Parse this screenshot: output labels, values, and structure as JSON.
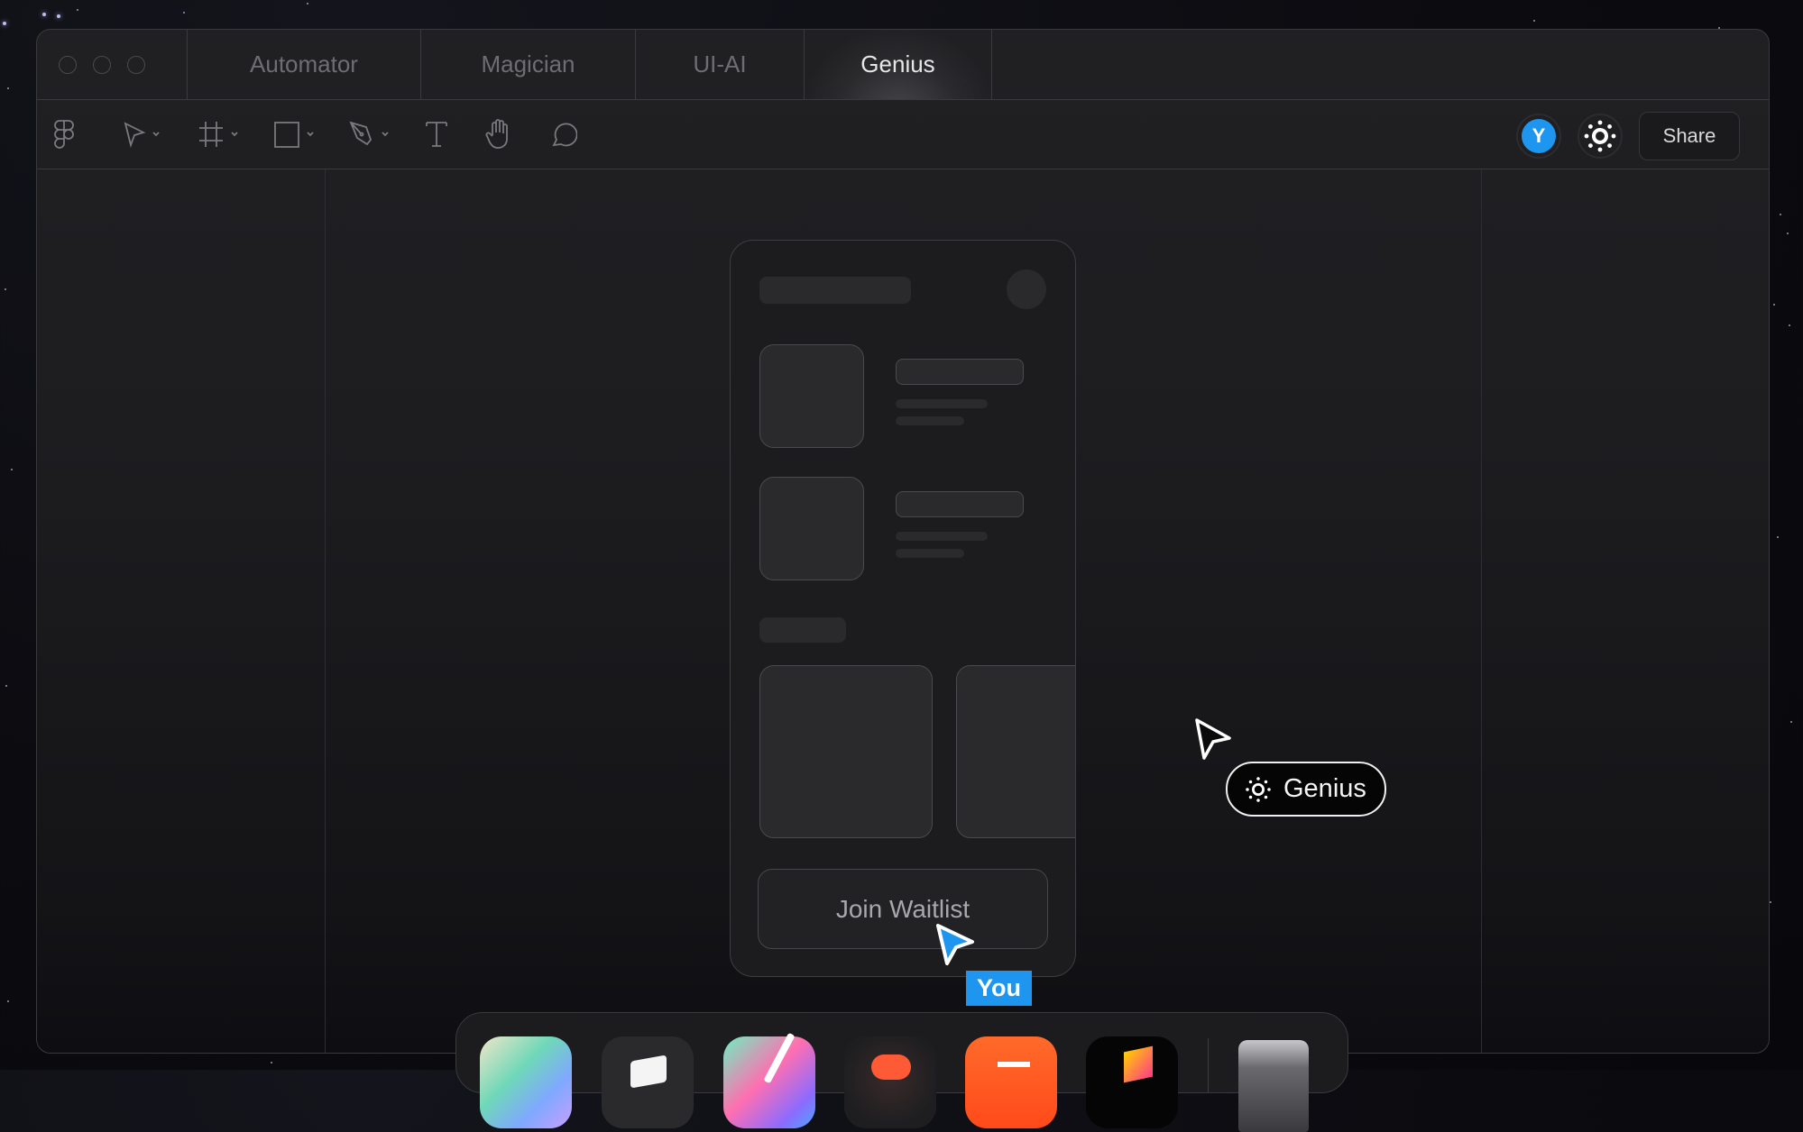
{
  "window": {
    "traffic_lights": [
      "close",
      "minimize",
      "maximize"
    ],
    "tabs": [
      {
        "label": "Automator",
        "active": false
      },
      {
        "label": "Magician",
        "active": false
      },
      {
        "label": "UI-AI",
        "active": false
      },
      {
        "label": "Genius",
        "active": true
      }
    ]
  },
  "toolbar": {
    "tools": [
      {
        "icon": "figma-logo-icon",
        "has_dropdown": false
      },
      {
        "icon": "move-pointer-icon",
        "has_dropdown": true
      },
      {
        "icon": "frame-hash-icon",
        "has_dropdown": true
      },
      {
        "icon": "rectangle-icon",
        "has_dropdown": true
      },
      {
        "icon": "pen-icon",
        "has_dropdown": true
      },
      {
        "icon": "text-icon",
        "has_dropdown": false
      },
      {
        "icon": "hand-icon",
        "has_dropdown": false
      },
      {
        "icon": "comment-icon",
        "has_dropdown": false
      }
    ],
    "avatar_initial": "Y",
    "share_label": "Share",
    "accent_color": "#1e96f0"
  },
  "canvas": {
    "phone_mockup": {
      "button_label": "Join Waitlist"
    },
    "cursors": [
      {
        "label": "You",
        "color": "#1e96f0"
      },
      {
        "label": "Genius",
        "icon": "sun-sparkle-icon",
        "color": "#050505"
      }
    ]
  },
  "dock": {
    "apps": [
      "gradient-app-icon",
      "notes-app-icon",
      "design-tool-app-icon",
      "figma-app-icon",
      "orange-app-icon",
      "3d-cube-app-icon"
    ],
    "trash": "trash-icon"
  }
}
